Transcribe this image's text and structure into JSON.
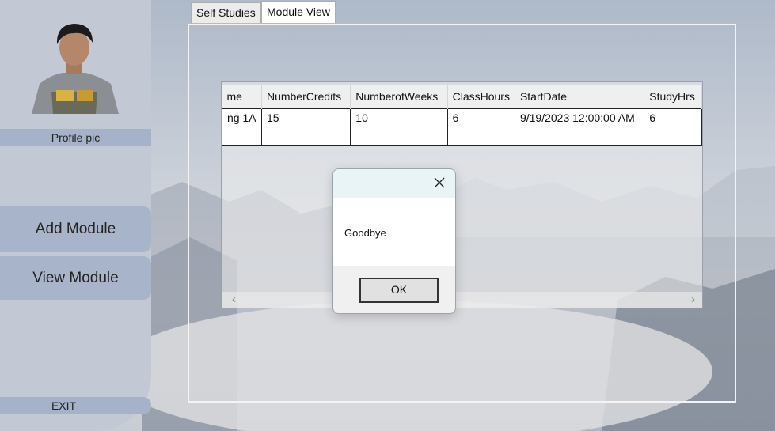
{
  "sidebar": {
    "profile_label": "Profile pic",
    "add_module_label": "Add Module",
    "view_module_label": "View Module",
    "exit_label": "EXIT"
  },
  "tabs": [
    {
      "label": "Self Studies",
      "selected": false
    },
    {
      "label": "Module View",
      "selected": true
    }
  ],
  "grid": {
    "columns": [
      "me",
      "NumberCredits",
      "NumberofWeeks",
      "ClassHours",
      "StartDate",
      "StudyHrs"
    ],
    "rows": [
      [
        "ng 1A",
        "15",
        "10",
        "6",
        "9/19/2023 12:00:00 AM",
        "6"
      ],
      [
        "",
        "",
        "",
        "",
        "",
        ""
      ]
    ]
  },
  "dialog": {
    "message": "Goodbye",
    "ok_label": "OK"
  }
}
